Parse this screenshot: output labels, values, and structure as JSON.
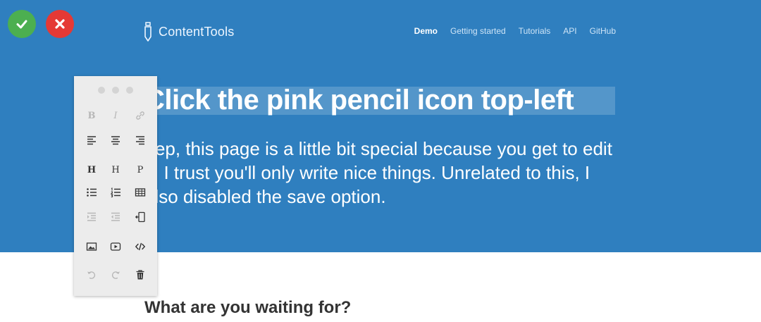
{
  "editor": {
    "confirm_icon": "check-icon",
    "cancel_icon": "x-icon"
  },
  "brand": {
    "name": "ContentTools",
    "icon": "pencil-icon"
  },
  "nav": [
    "Demo",
    "Getting started",
    "Tutorials",
    "API",
    "GitHub"
  ],
  "hero": {
    "heading": "Click the pink pencil icon top-left",
    "paragraph_lines": [
      "Yep, this page is a little bit special because you get to edit",
      "it. I trust you'll only write nice things. Unrelated to this, I",
      "also disabled the save option."
    ]
  },
  "subheading": "What are you waiting for?",
  "toolbox": {
    "bold": "B",
    "italic": "I",
    "heading": "H",
    "subheading": "H",
    "paragraph": "P"
  },
  "colors": {
    "hero_bg": "#2f7fbf",
    "confirm": "#4caf50",
    "cancel": "#e53935",
    "toolbox_bg": "#ececec"
  }
}
